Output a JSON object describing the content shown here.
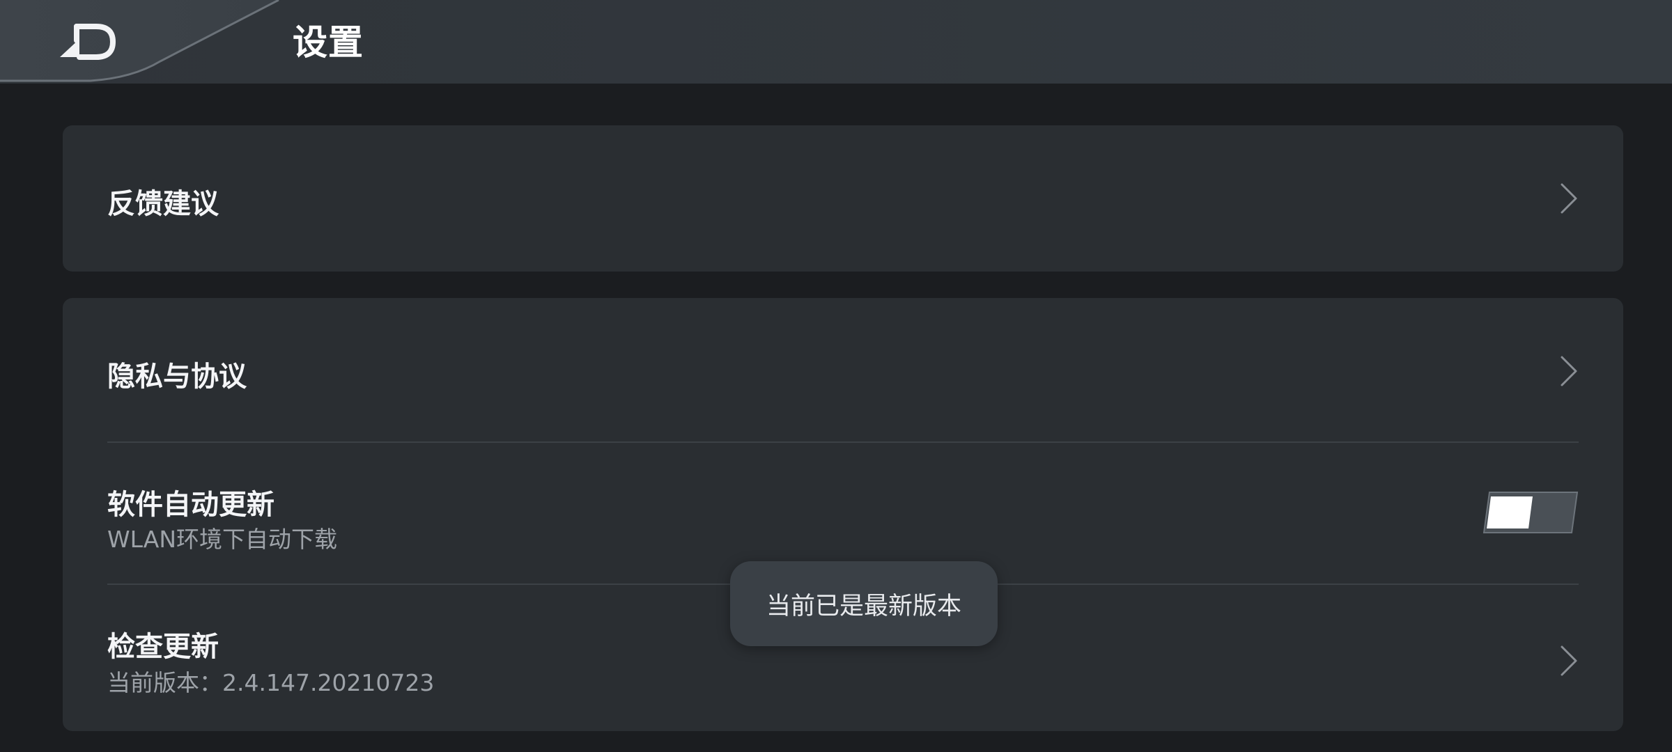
{
  "header": {
    "title": "设置",
    "back_icon": "back-arrow-icon"
  },
  "sections": [
    {
      "items": [
        {
          "title": "反馈建议",
          "type": "link",
          "icon": "chevron-right-icon"
        }
      ]
    },
    {
      "items": [
        {
          "title": "隐私与协议",
          "type": "link",
          "icon": "chevron-right-icon"
        },
        {
          "title": "软件自动更新",
          "subtitle": "WLAN环境下自动下载",
          "type": "toggle",
          "toggle_on": false
        },
        {
          "title": "检查更新",
          "subtitle": "当前版本：2.4.147.20210723",
          "type": "link",
          "icon": "chevron-right-icon"
        }
      ]
    }
  ],
  "toast": {
    "text": "当前已是最新版本"
  },
  "colors": {
    "background": "#1b1d20",
    "card": "#2a2e32",
    "topbar": "#32373c",
    "accent_white": "#ffffff"
  }
}
